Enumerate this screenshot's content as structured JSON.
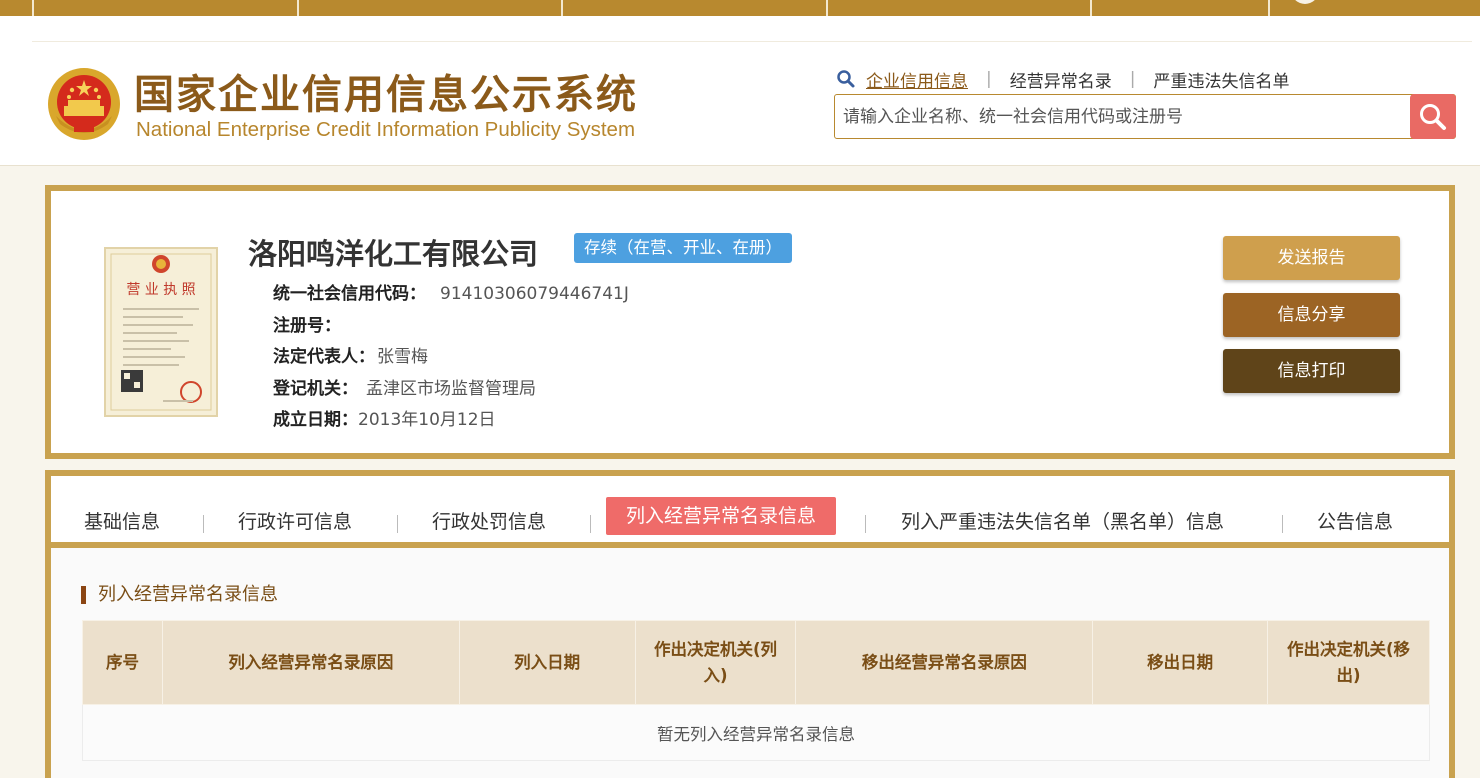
{
  "header": {
    "title_cn": "国家企业信用信息公示系统",
    "title_en": "National Enterprise Credit Information Publicity System",
    "nav": [
      "企业信用信息",
      "经营异常名录",
      "严重违法失信名单"
    ],
    "search_placeholder": "请输入企业名称、统一社会信用代码或注册号"
  },
  "company": {
    "name": "洛阳鸣洋化工有限公司",
    "status": "存续（在营、开业、在册）",
    "fields": [
      {
        "label": "统一社会信用代码：",
        "value": "91410306079446741J"
      },
      {
        "label": "注册号：",
        "value": ""
      },
      {
        "label": "法定代表人：",
        "value": "张雪梅"
      },
      {
        "label": "登记机关：",
        "value": "孟津区市场监督管理局"
      },
      {
        "label": "成立日期：",
        "value": "2013年10月12日"
      }
    ],
    "license_title": "营 业 执 照",
    "actions": [
      "发送报告",
      "信息分享",
      "信息打印"
    ]
  },
  "tabs": [
    "基础信息",
    "行政许可信息",
    "行政处罚信息",
    "列入经营异常名录信息",
    "列入严重违法失信名单（黑名单）信息",
    "公告信息"
  ],
  "section": {
    "title": "列入经营异常名录信息",
    "columns": [
      "序号",
      "列入经营异常名录原因",
      "列入日期",
      "作出决定机关(列入)",
      "移出经营异常名录原因",
      "移出日期",
      "作出决定机关(移出)"
    ],
    "empty_text": "暂无列入经营异常名录信息"
  },
  "colors": {
    "brand_gold": "#c9a24f",
    "brand_brown": "#8b5a1a",
    "status_blue": "#4da0e0",
    "active_tab": "#ef6b69",
    "action_1": "#cf9f4d",
    "action_2": "#9c6424",
    "action_3": "#5f4419"
  }
}
